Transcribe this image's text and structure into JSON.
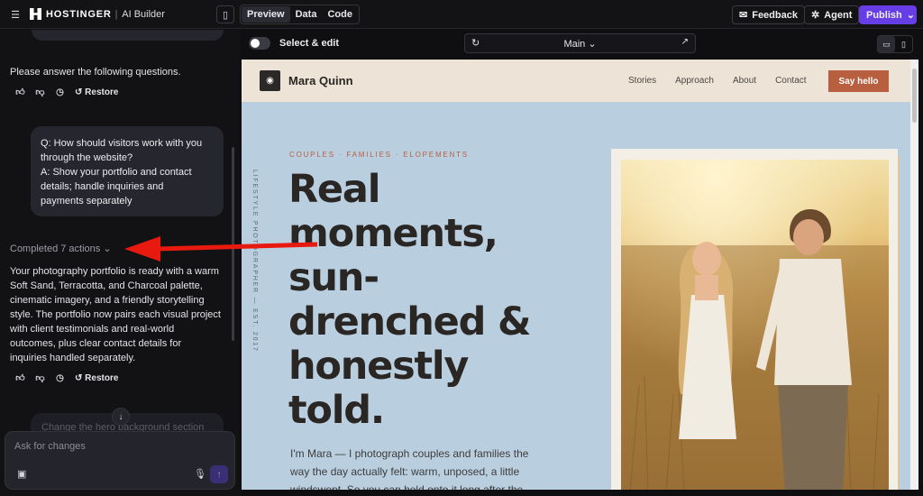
{
  "topbar": {
    "brand": "HOSTINGER",
    "product": "AI Builder",
    "tabs": [
      "Preview",
      "Data",
      "Code"
    ],
    "feedback_label": "Feedback",
    "agent_label": "Agent",
    "publish_label": "Publish",
    "accent": "#673de6"
  },
  "chat": {
    "prompt_text": "Please answer the following questions.",
    "restore_label": "Restore",
    "user_lines": [
      "Q: How should visitors work with you",
      "through the website?",
      "A: Show your portfolio and contact",
      "details; handle inquiries and",
      "payments separately"
    ],
    "completed_label": "Completed 7 actions",
    "reply_lines": [
      "Your photography portfolio is ready with a warm",
      "Soft Sand, Terracotta, and Charcoal palette,",
      "cinematic imagery, and a friendly storytelling",
      "style. The portfolio now pairs each visual project",
      "with client testimonials and real-world",
      "outcomes, plus clear contact details for",
      "inquiries handled separately."
    ],
    "pending_message": "Change the hero background section",
    "composer_placeholder": "Ask for changes"
  },
  "preview_toolbar": {
    "select_edit_label": "Select & edit",
    "page_label": "Main"
  },
  "site": {
    "brand": "Mara Quinn",
    "nav": [
      "Stories",
      "Approach",
      "About",
      "Contact"
    ],
    "cta": "Say hello",
    "vertical_text": "LIFESTYLE PHOTOGRAPHER — EST. 2017",
    "eyebrow": "COUPLES · FAMILIES · ELOPEMENTS",
    "headline_lines": [
      "Real",
      "moments,",
      "sun-",
      "drenched &",
      "honestly",
      "told."
    ],
    "lede_lines": [
      "I'm Mara — I photograph couples and families the",
      "way the day actually felt: warm, unposed, a little",
      "windswept. So you can hold onto it long after the"
    ],
    "colors": {
      "sand": "#ede3d6",
      "terracotta": "#b85f3f",
      "charcoal": "#2a2624",
      "sky": "#b9cfe0"
    }
  }
}
